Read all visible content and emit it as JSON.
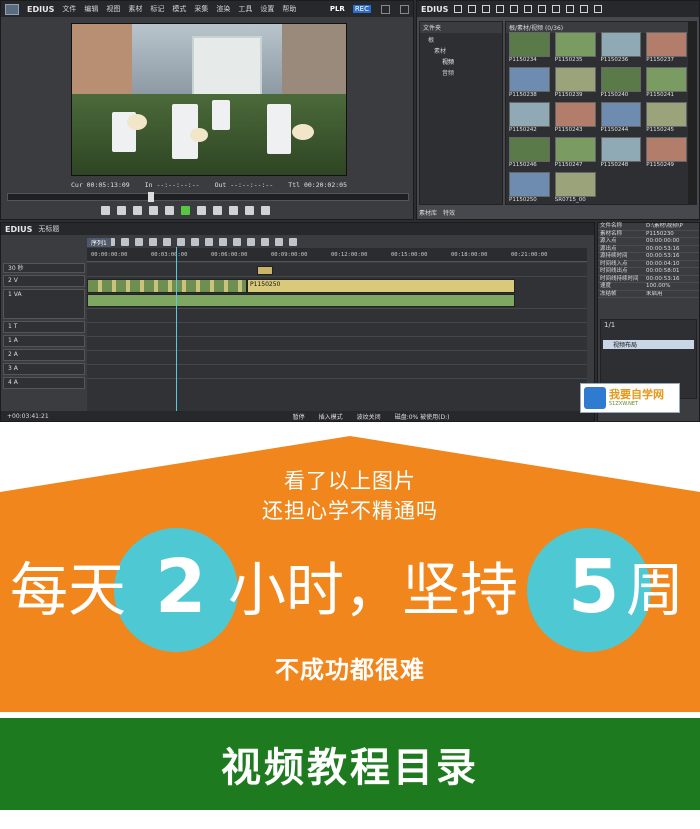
{
  "player": {
    "app_name": "EDIUS",
    "menu": [
      "文件",
      "编辑",
      "视图",
      "素材",
      "标记",
      "模式",
      "采集",
      "渲染",
      "工具",
      "设置",
      "帮助"
    ],
    "mode_label": "PLR",
    "rec_label": "REC",
    "timecodes": {
      "cur": "Cur 00:05:13:09",
      "in": "In --:--:--:--",
      "out": "Out --:--:--:--",
      "ttl": "Ttl 00:20:02:05"
    }
  },
  "bin": {
    "app_name": "EDIUS",
    "tree_header": "文件夹",
    "tree": [
      "根",
      "素材",
      "视频",
      "音频"
    ],
    "path": "根/素材/视频 (0/36)",
    "thumbnails": [
      "P1150234",
      "P1150235",
      "P1150236",
      "P1150237",
      "P1150238",
      "P1150239",
      "P1150240",
      "P1150241",
      "P1150242",
      "P1150243",
      "P1150244",
      "P1150245",
      "P1150246",
      "P1150247",
      "P1150248",
      "P1150249",
      "P1150250",
      "SR0715_00"
    ],
    "tabs": [
      "素材库",
      "特效"
    ]
  },
  "timeline": {
    "title": "EDIUS",
    "project": "无标题",
    "sequence_tab": "序列1",
    "ruler": [
      "00:00:00:00",
      "00:03:00:00",
      "00:06:00:00",
      "00:09:00:00",
      "00:12:00:00",
      "00:15:00:00",
      "00:18:00:00",
      "00:21:00:00"
    ],
    "tracks": [
      "2 V",
      "1 VA",
      "1 T",
      "1 A",
      "2 A",
      "3 A",
      "4 A"
    ],
    "clip_label": "P1150250",
    "zoom": "30 秒",
    "status": [
      "+00:03:41:21",
      "暂停",
      "插入模式",
      "波纹关闭",
      "磁盘:0% 被使用(D:)"
    ]
  },
  "info": {
    "rows": [
      [
        "文件名称",
        "D:\\素材\\视频\\P"
      ],
      [
        "素材名称",
        "P1150230"
      ],
      [
        "源入点",
        "00:00:00:00"
      ],
      [
        "源出点",
        "00:00:53:16"
      ],
      [
        "源持续时间",
        "00:00:53:16"
      ],
      [
        "时间线入点",
        "00:00:04:10"
      ],
      [
        "时间线出点",
        "00:00:58:01"
      ],
      [
        "时间线持续时间",
        "00:00:53:16"
      ],
      [
        "速度",
        "100.00%"
      ],
      [
        "冻结帧",
        "未启用"
      ]
    ],
    "effect_page": "1/1",
    "effect_item": "视频布局"
  },
  "watermark": {
    "text": "我要自学网",
    "url": "51ZXW.NET"
  },
  "promo": {
    "line1": "看了以上图片",
    "line2": "还担心学不精通吗",
    "big_a": "每天",
    "num_a": "2",
    "big_b": "小时，坚持",
    "num_b": "5",
    "big_c": "周",
    "line3": "不成功都很难",
    "banner_title": "视频教程目录"
  },
  "colors": {
    "orange": "#f0861c",
    "cyan": "#4ec9d4",
    "green": "#1e7a1e"
  }
}
